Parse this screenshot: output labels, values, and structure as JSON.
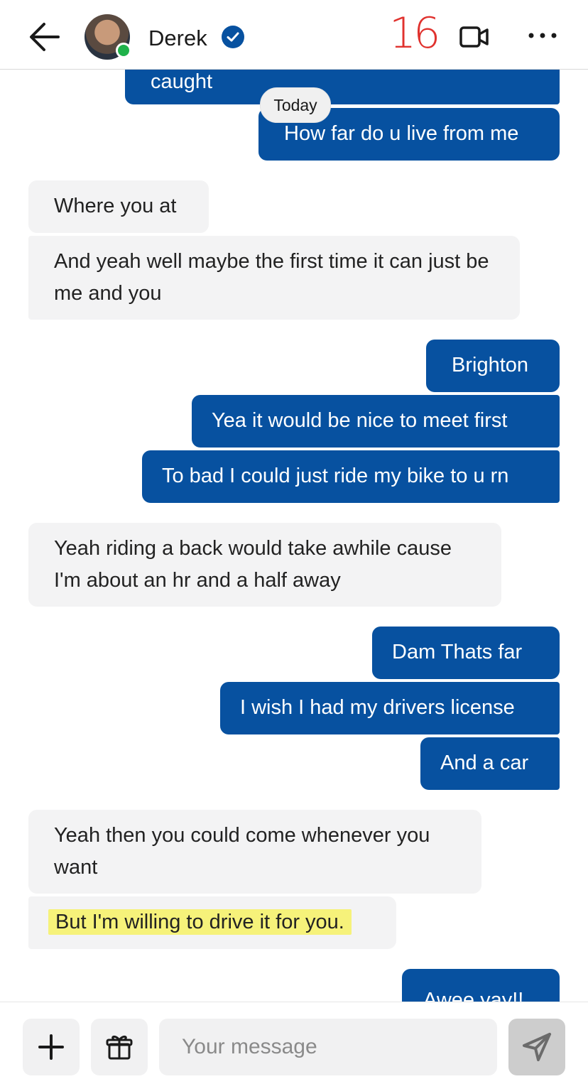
{
  "header": {
    "contact_name": "Derek",
    "annotation": "16",
    "icons": [
      "back-arrow-icon",
      "verified-badge-icon",
      "video-call-icon",
      "more-options-icon"
    ]
  },
  "colors": {
    "outgoing_bubble": "#0751a0",
    "incoming_bubble": "#f3f3f4",
    "online_status": "#1fb24a",
    "highlight": "#f6f27a",
    "annotation": "#e0322e"
  },
  "conversation": {
    "day_separator": "Today",
    "messages": [
      {
        "direction": "outgoing",
        "text": "caught"
      },
      {
        "direction": "outgoing",
        "text": "How far do u live from me"
      },
      {
        "direction": "incoming",
        "text": "Where you at"
      },
      {
        "direction": "incoming",
        "text": "And yeah well maybe the first time it can just be me and you"
      },
      {
        "direction": "outgoing",
        "text": "Brighton"
      },
      {
        "direction": "outgoing",
        "text": "Yea it would be nice to meet first"
      },
      {
        "direction": "outgoing",
        "text": "To bad I could just ride my bike to u rn"
      },
      {
        "direction": "incoming",
        "text": "Yeah riding a back would take awhile cause I'm about an hr and a half away"
      },
      {
        "direction": "outgoing",
        "text": "Dam Thats far"
      },
      {
        "direction": "outgoing",
        "text": "I wish I had my drivers license"
      },
      {
        "direction": "outgoing",
        "text": "And a car"
      },
      {
        "direction": "incoming",
        "text": "Yeah then you could come whenever you want"
      },
      {
        "direction": "incoming",
        "text": "But I'm willing to drive it for you.",
        "highlighted": true
      },
      {
        "direction": "outgoing",
        "text": "Awee yay!!"
      }
    ]
  },
  "composer": {
    "placeholder": "Your message",
    "value": "",
    "icons": [
      "plus-icon",
      "gift-icon",
      "send-icon"
    ]
  }
}
